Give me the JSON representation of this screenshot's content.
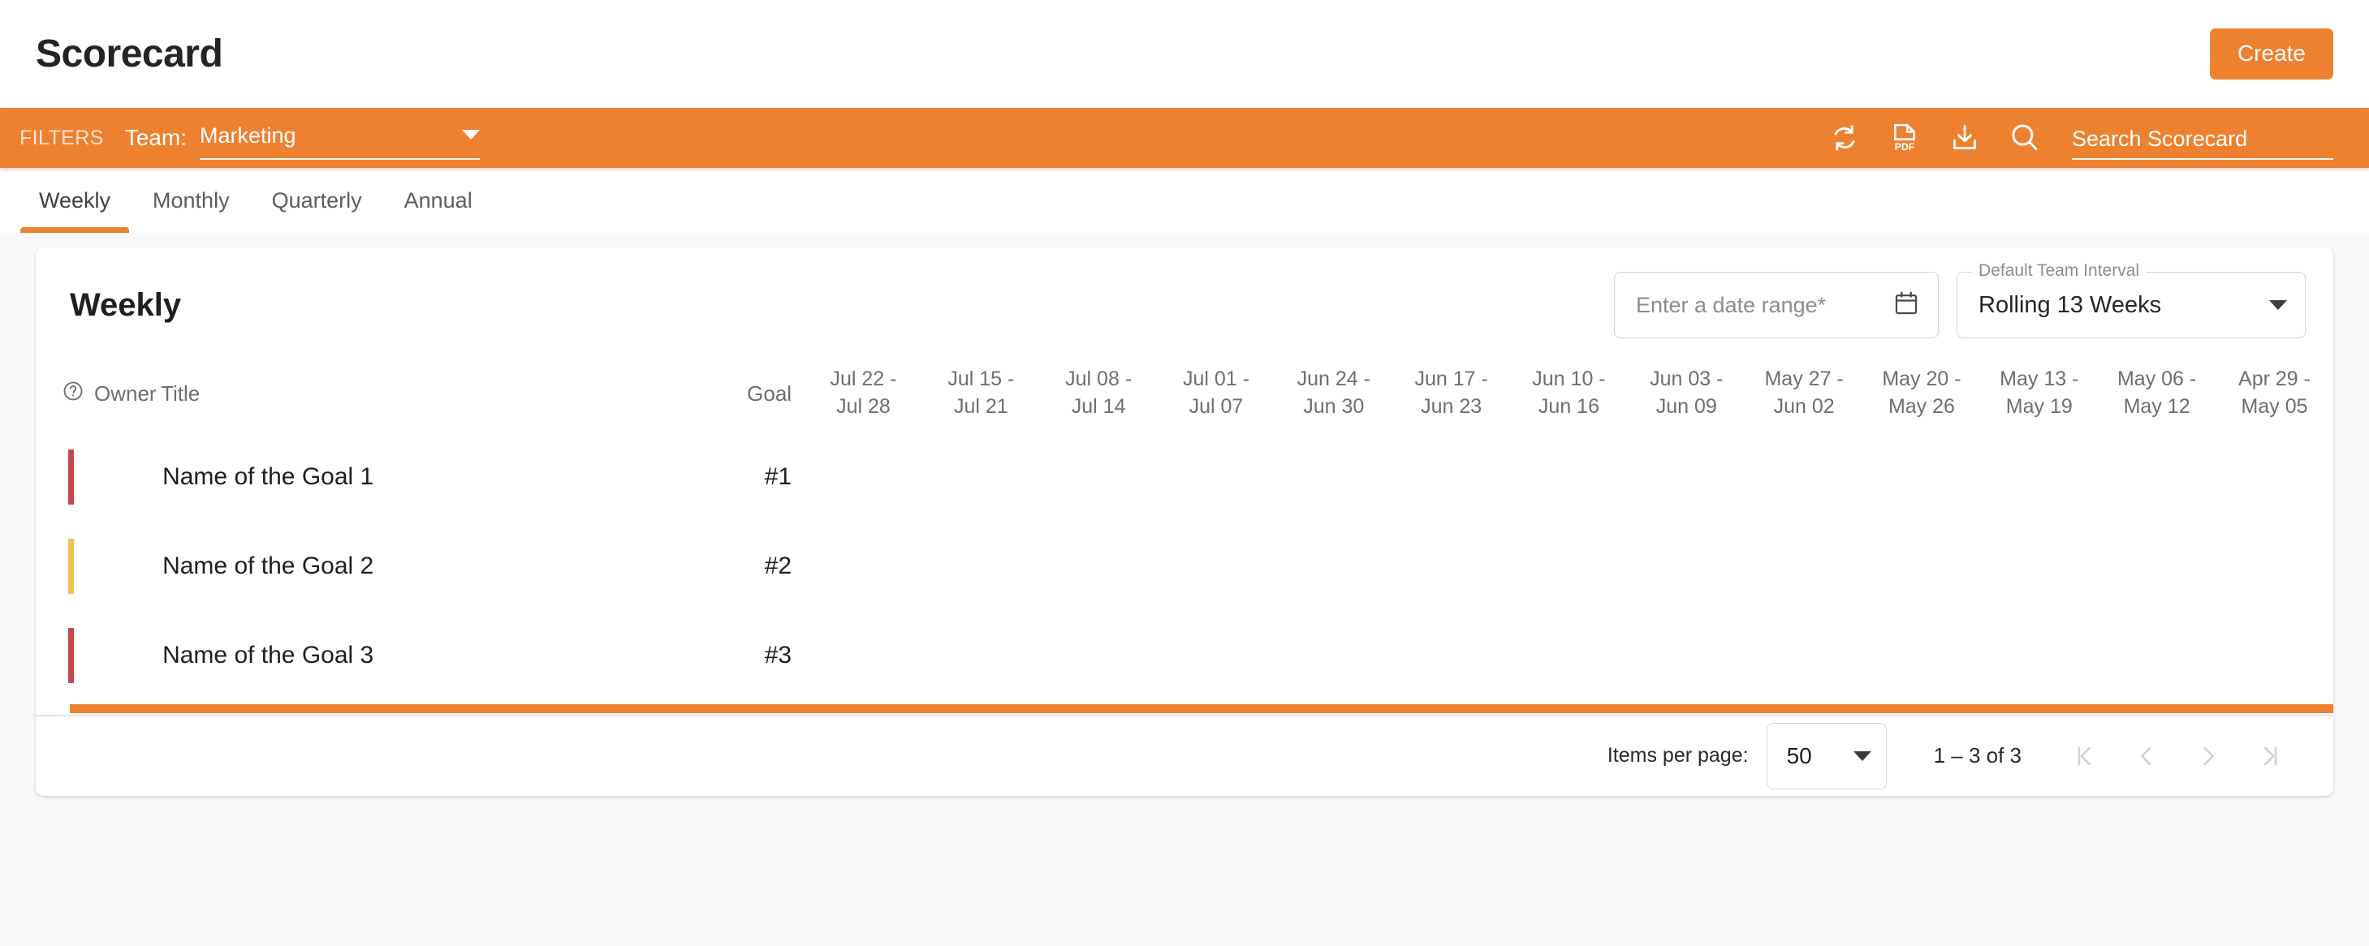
{
  "header": {
    "title": "Scorecard",
    "create_label": "Create"
  },
  "filter_bar": {
    "filters_label": "FILTERS",
    "team_label": "Team:",
    "team_value": "Marketing",
    "icons": [
      "refresh-icon",
      "pdf-icon",
      "download-icon",
      "search-icon"
    ],
    "search_placeholder": "Search Scorecard",
    "background_color": "#ED8130"
  },
  "tabs": [
    {
      "label": "Weekly",
      "active": true
    },
    {
      "label": "Monthly",
      "active": false
    },
    {
      "label": "Quarterly",
      "active": false
    },
    {
      "label": "Annual",
      "active": false
    }
  ],
  "card": {
    "title": "Weekly",
    "date_range": {
      "placeholder": "Enter a date range*",
      "value": "",
      "icon": "calendar-icon"
    },
    "interval": {
      "legend": "Default Team Interval",
      "value": "Rolling 13 Weeks"
    }
  },
  "table": {
    "headers": {
      "owner": "Owner",
      "owner_icon": "help-circle-icon",
      "title": "Title",
      "goal": "Goal"
    },
    "week_columns": [
      "Jul 22 -\nJul 28",
      "Jul 15 -\nJul 21",
      "Jul 08 -\nJul 14",
      "Jul 01 -\nJul 07",
      "Jun 24 -\nJun 30",
      "Jun 17 -\nJun 23",
      "Jun 10 -\nJun 16",
      "Jun 03 -\nJun 09",
      "May 27 -\nJun 02",
      "May 20 -\nMay 26",
      "May 13 -\nMay 19",
      "May 06 -\nMay 12",
      "Apr 29 -\nMay 05"
    ],
    "rows": [
      {
        "status_color": "#C5474B",
        "title": "Name of the Goal 1",
        "goal": "#1"
      },
      {
        "status_color": "#EFC14E",
        "title": "Name of the Goal 2",
        "goal": "#2"
      },
      {
        "status_color": "#C5474B",
        "title": "Name of the Goal 3",
        "goal": "#3"
      }
    ]
  },
  "paginator": {
    "items_per_page_label": "Items per page:",
    "items_per_page_value": "50",
    "range_label": "1 – 3 of 3",
    "buttons": [
      "first-page-icon",
      "previous-page-icon",
      "next-page-icon",
      "last-page-icon"
    ]
  },
  "scrollbar": {
    "color": "#ED8130"
  }
}
